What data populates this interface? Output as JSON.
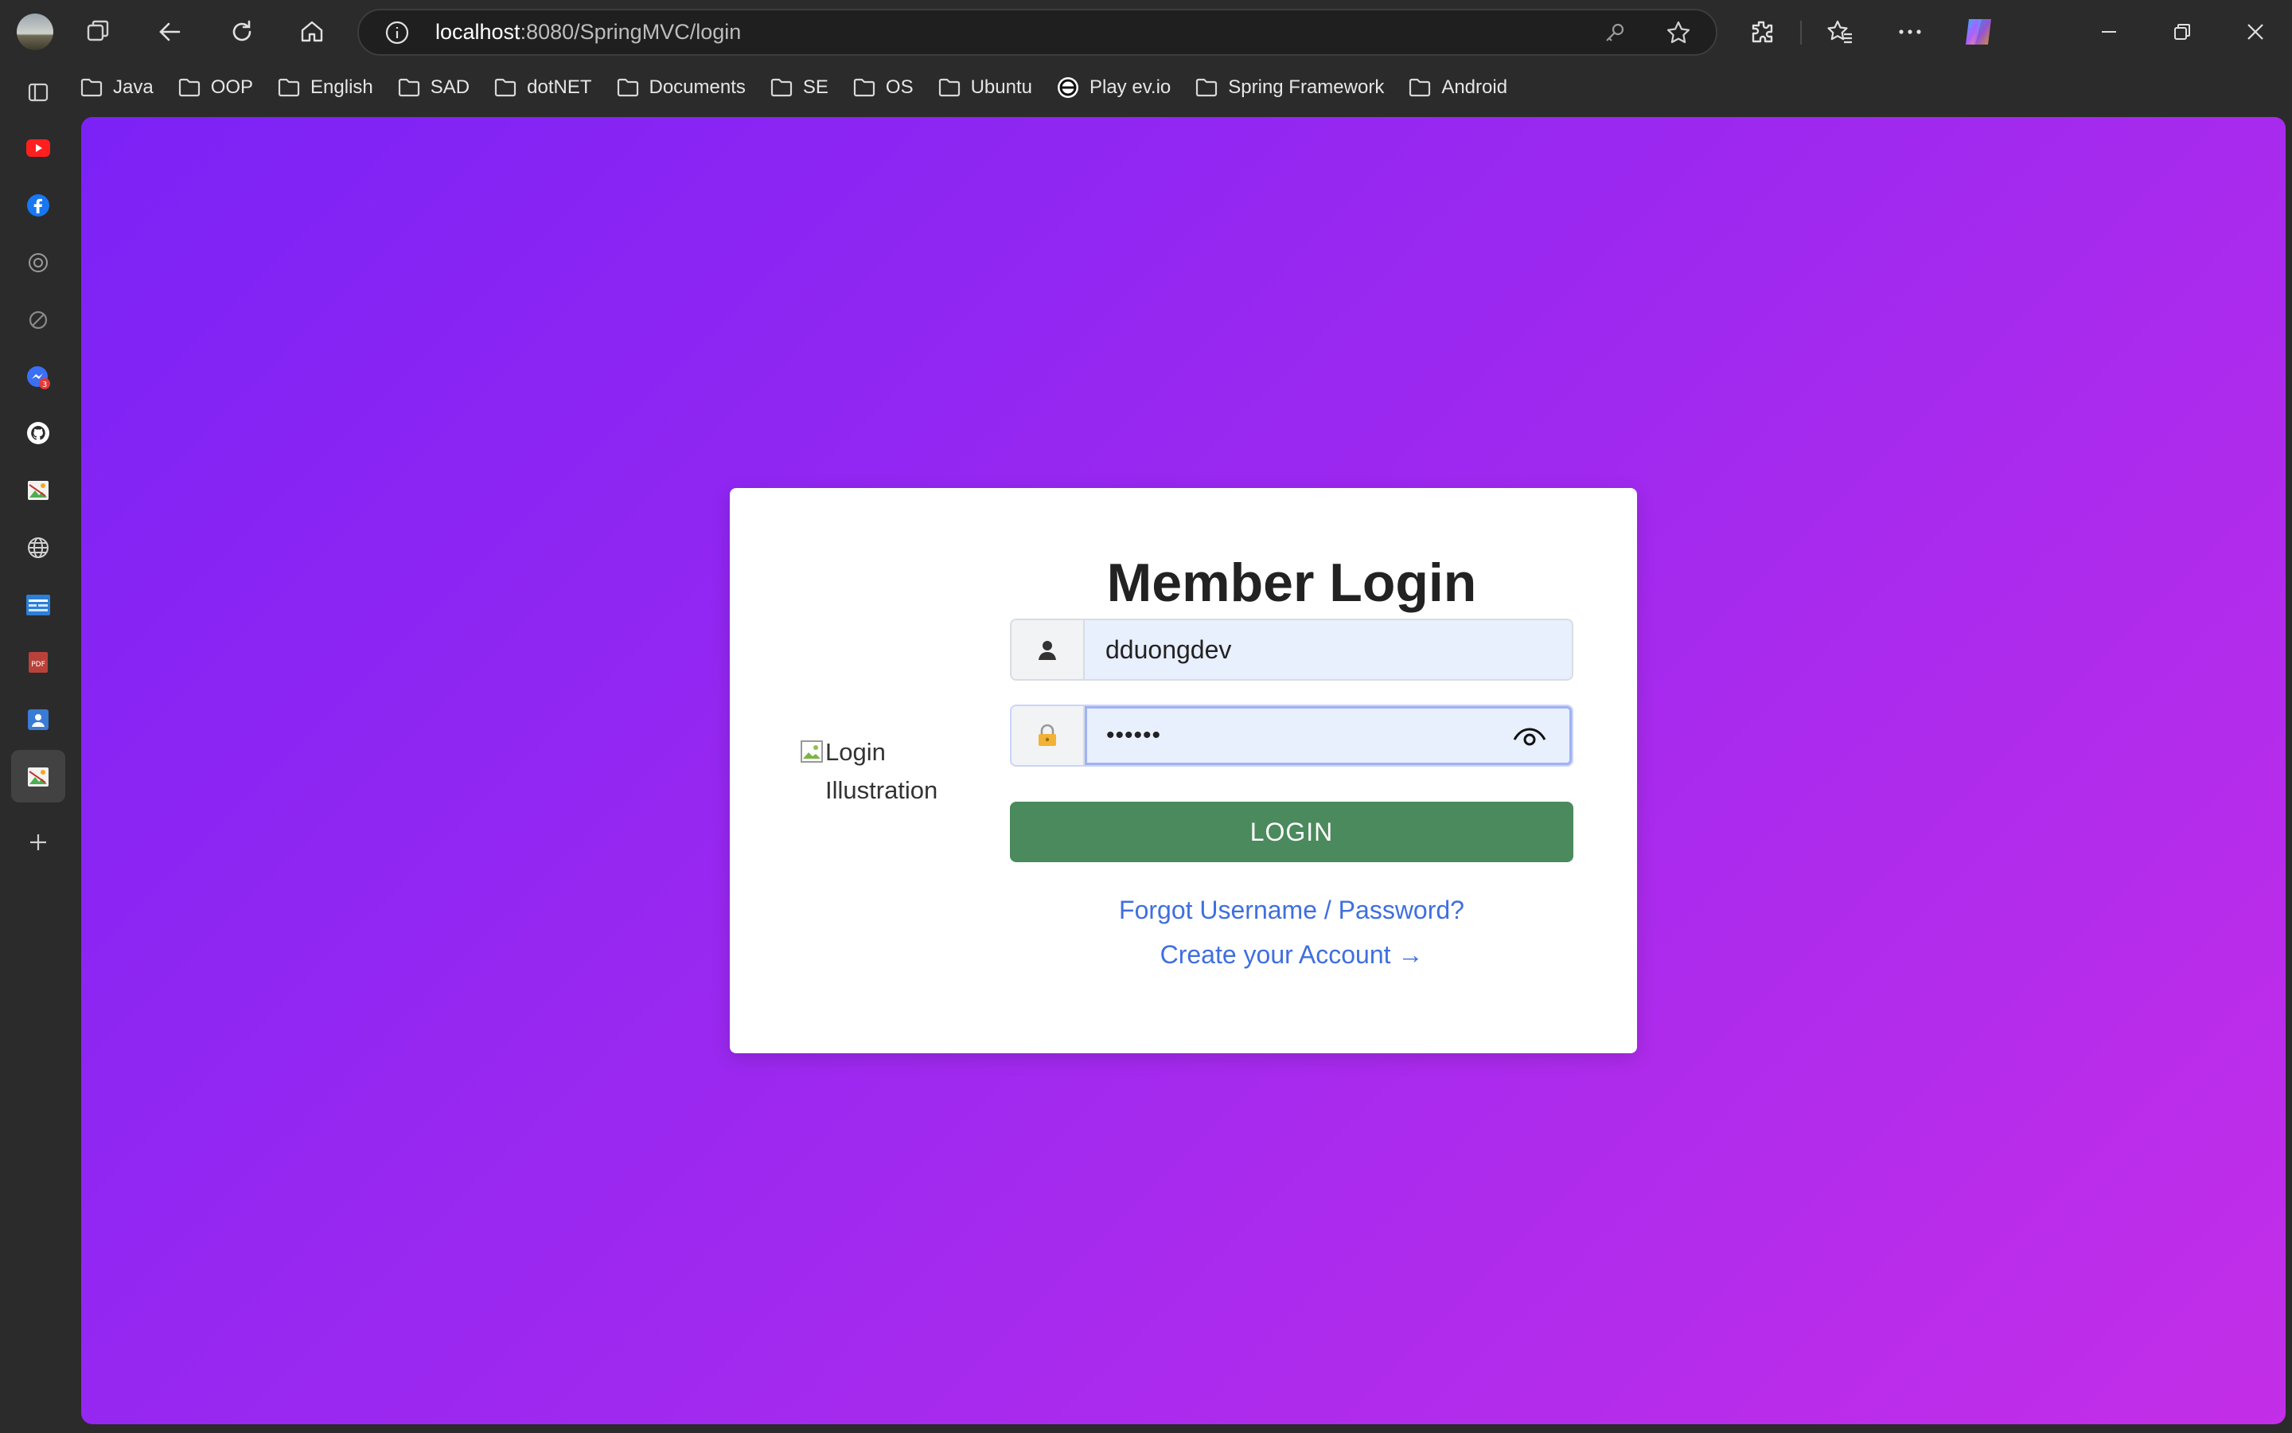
{
  "browser": {
    "url_host": "localhost",
    "url_path": ":8080/SpringMVC/login"
  },
  "bookmarks": [
    {
      "label": "Java",
      "icon": "folder-icon"
    },
    {
      "label": "OOP",
      "icon": "folder-icon"
    },
    {
      "label": "English",
      "icon": "folder-icon"
    },
    {
      "label": "SAD",
      "icon": "folder-icon"
    },
    {
      "label": "dotNET",
      "icon": "folder-icon"
    },
    {
      "label": "Documents",
      "icon": "folder-icon"
    },
    {
      "label": "SE",
      "icon": "folder-icon"
    },
    {
      "label": "OS",
      "icon": "folder-icon"
    },
    {
      "label": "Ubuntu",
      "icon": "folder-icon"
    },
    {
      "label": "Play ev.io",
      "icon": "evio-icon"
    },
    {
      "label": "Spring Framework",
      "icon": "folder-icon"
    },
    {
      "label": "Android",
      "icon": "folder-icon"
    }
  ],
  "login": {
    "title": "Member Login",
    "illustration_alt": "Login Illustration",
    "username_value": "dduongdev",
    "password_masked": "••••••",
    "button_label": "LOGIN",
    "forgot_link": "Forgot Username / Password?",
    "create_link": "Create your Account →"
  },
  "colors": {
    "gradient_start": "#7c22f6",
    "gradient_end": "#c32ee8",
    "login_button": "#4a8a5c",
    "link": "#3f6fe0"
  }
}
